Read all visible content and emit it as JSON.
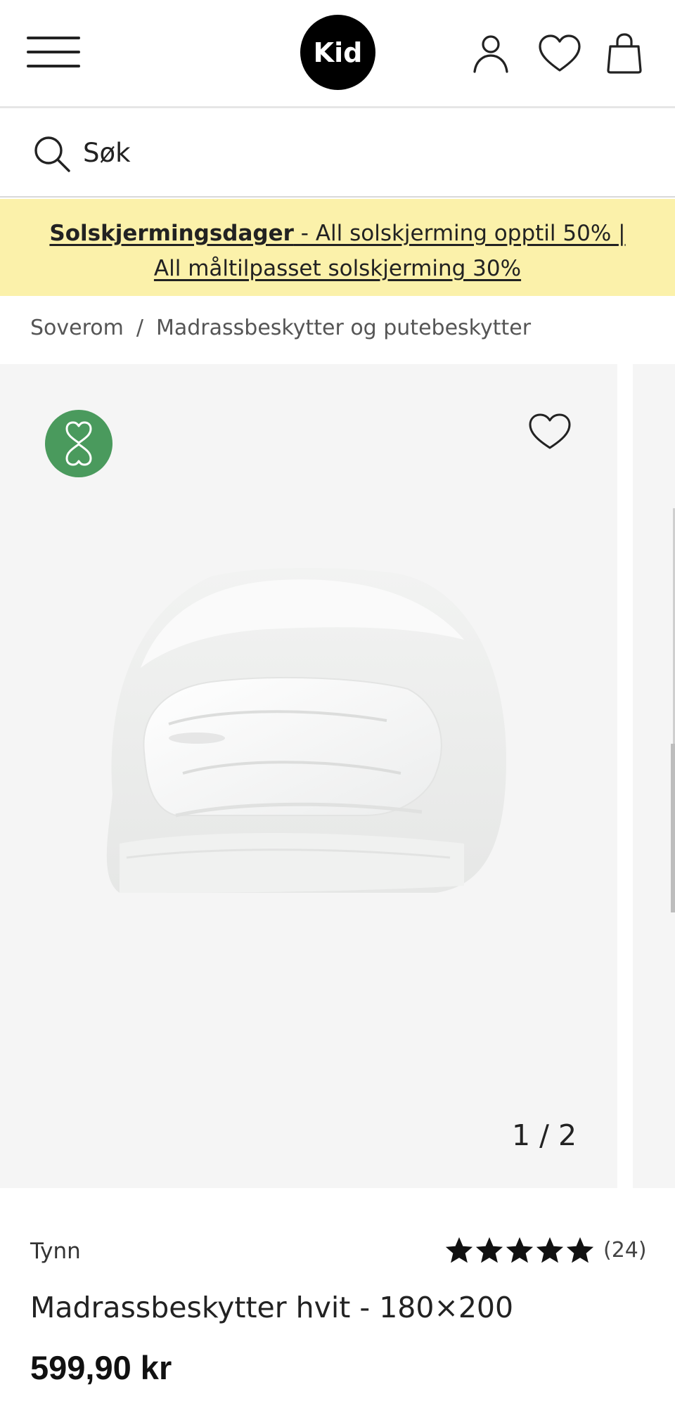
{
  "header": {
    "logo_text": "Kid",
    "icons": {
      "menu": "hamburger-menu-icon",
      "account": "user-icon",
      "wishlist": "heart-icon",
      "cart": "shopping-bag-icon"
    }
  },
  "search": {
    "placeholder": "Søk",
    "icon": "search-icon"
  },
  "banner": {
    "bold_text": "Solskjermingsdager",
    "text_part1": " - All solskjerming opptil 50% ",
    "text_part2": "| All måltilpasset solskjerming 30%",
    "background_color": "#fbf1aa"
  },
  "breadcrumb": {
    "items": [
      "Soverom",
      "Madrassbeskytter og putebeskytter"
    ],
    "separator": "/"
  },
  "gallery": {
    "badge_icon": "eco-hearts-icon",
    "badge_color": "#4a9a5d",
    "favorite_icon": "heart-icon",
    "counter": "1 / 2",
    "image_description_icon": "folded-white-towel-image"
  },
  "product": {
    "variant": "Tynn",
    "rating": 5,
    "rating_max": 5,
    "rating_count": "(24)",
    "title": "Madrassbeskytter hvit - 180×200",
    "price": "599,90 kr"
  }
}
